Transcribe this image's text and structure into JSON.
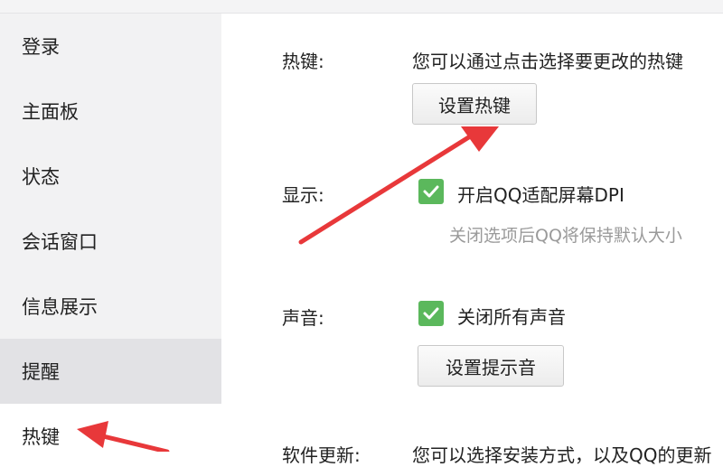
{
  "sidebar": {
    "items": [
      {
        "label": "登录"
      },
      {
        "label": "主面板"
      },
      {
        "label": "状态"
      },
      {
        "label": "会话窗口"
      },
      {
        "label": "信息展示"
      },
      {
        "label": "提醒"
      },
      {
        "label": "热键"
      }
    ]
  },
  "hotkey": {
    "label": "热键:",
    "desc": "您可以通过点击选择要更改的热键",
    "button": "设置热键"
  },
  "display": {
    "label": "显示:",
    "option": "开启QQ适配屏幕DPI",
    "hint": "关闭选项后QQ将保持默认大小"
  },
  "sound": {
    "label": "声音:",
    "option": "关闭所有声音",
    "button": "设置提示音"
  },
  "update": {
    "label": "软件更新:",
    "desc": "您可以选择安装方式，以及QQ的更新"
  },
  "colors": {
    "accent_arrow": "#e8383a",
    "check": "#5bb85c"
  }
}
